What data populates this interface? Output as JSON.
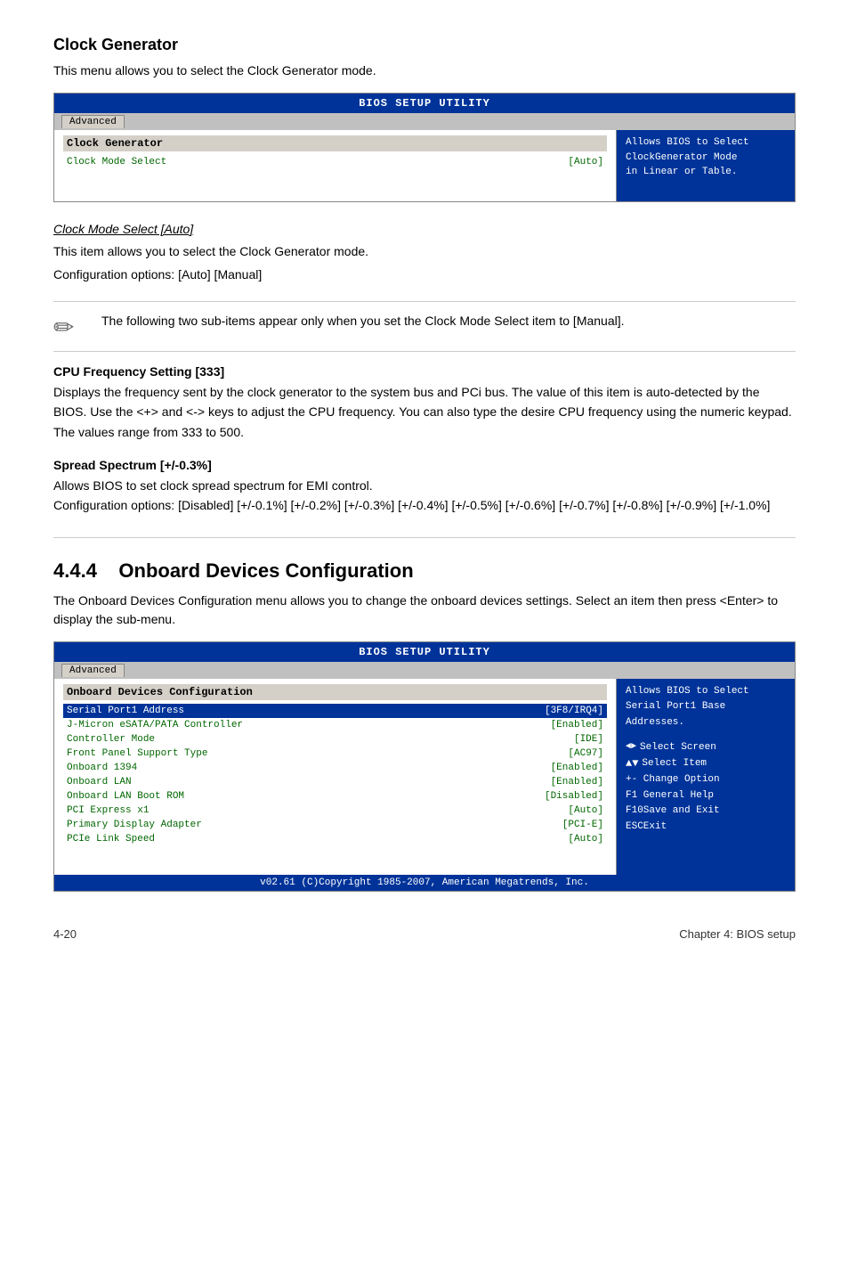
{
  "page": {
    "footer_left": "4-20",
    "footer_right": "Chapter 4: BIOS setup"
  },
  "clock_generator": {
    "title": "Clock Generator",
    "intro": "This menu allows you to select the Clock Generator mode.",
    "bios_header": "BIOS SETUP UTILITY",
    "tab_label": "Advanced",
    "item_header": "Clock Generator",
    "item_row_label": "Clock Mode Select",
    "item_row_value": "[Auto]",
    "help_line1": "Allows BIOS to Select",
    "help_line2": "ClockGenerator Mode",
    "help_line3": "in Linear or Table.",
    "sub_title": "Clock Mode Select [Auto]",
    "sub_desc1": "This item allows you to select the Clock Generator mode.",
    "sub_desc2": "Configuration options: [Auto] [Manual]",
    "note_text": "The following two sub-items appear only when you set the Clock Mode Select item to [Manual].",
    "cpu_title": "CPU Frequency Setting [333]",
    "cpu_desc": "Displays the frequency sent by the clock generator to the system bus and PCi bus. The value of this item is auto-detected by the BIOS. Use the <+> and <-> keys to adjust the CPU frequency. You can also type the desire CPU frequency using the numeric keypad. The values range from 333 to 500.",
    "spread_title": "Spread Spectrum [+/-0.3%]",
    "spread_desc1": "Allows BIOS to set clock spread spectrum for EMI control.",
    "spread_desc2": "Configuration options: [Disabled] [+/-0.1%] [+/-0.2%] [+/-0.3%] [+/-0.4%] [+/-0.5%] [+/-0.6%] [+/-0.7%] [+/-0.8%] [+/-0.9%] [+/-1.0%]"
  },
  "onboard": {
    "section_num": "4.4.4",
    "section_title": "Onboard Devices Configuration",
    "intro": "The Onboard Devices Configuration menu allows you to change the onboard devices settings. Select an item then press <Enter> to display the sub-menu.",
    "bios_header": "BIOS SETUP UTILITY",
    "tab_label": "Advanced",
    "item_header": "Onboard Devices Configuration",
    "help_line1": "Allows BIOS to Select",
    "help_line2": "Serial Port1 Base",
    "help_line3": "Addresses.",
    "items": [
      {
        "label": "Serial Port1 Address",
        "value": "[3F8/IRQ4]",
        "selected": true
      },
      {
        "label": "J-Micron eSATA/PATA Controller",
        "value": "[Enabled]",
        "selected": false
      },
      {
        "label": "   Controller Mode",
        "value": "[IDE]",
        "selected": false
      },
      {
        "label": "Front Panel Support Type",
        "value": "[AC97]",
        "selected": false
      },
      {
        "label": "Onboard 1394",
        "value": "[Enabled]",
        "selected": false
      },
      {
        "label": "Onboard LAN",
        "value": "[Enabled]",
        "selected": false
      },
      {
        "label": " Onboard LAN Boot ROM",
        "value": "[Disabled]",
        "selected": false
      },
      {
        "label": "PCI Express x1",
        "value": "[Auto]",
        "selected": false
      },
      {
        "label": "Primary Display Adapter",
        "value": "[PCI-E]",
        "selected": false
      },
      {
        "label": "PCIe Link Speed",
        "value": "[Auto]",
        "selected": false
      }
    ],
    "nav_select_screen": "Select Screen",
    "nav_select_item": "Select Item",
    "nav_change_option": "+- Change Option",
    "nav_general_help": "F1 General Help",
    "nav_save_exit": "F10Save and Exit",
    "nav_esc_exit": "ESCExit",
    "copyright": "v02.61 (C)Copyright 1985-2007, American Megatrends, Inc."
  }
}
